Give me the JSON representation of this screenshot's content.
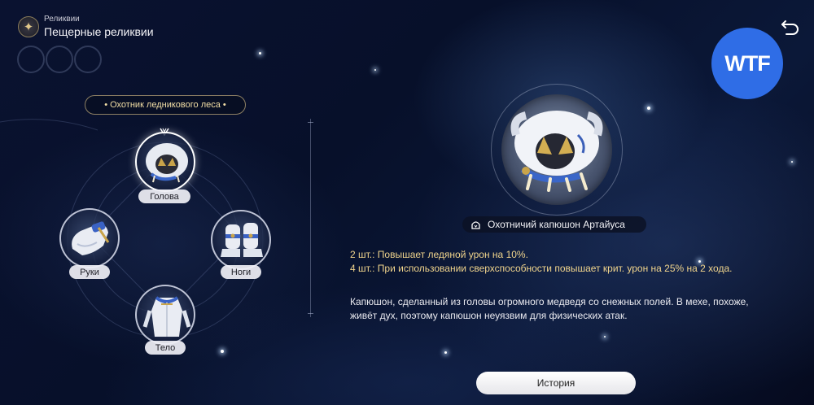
{
  "header": {
    "subtitle": "Реликвии",
    "title": "Пещерные реликвии",
    "icon": "compass-star-icon",
    "back_icon": "return-arrow-icon"
  },
  "watermark": {
    "label": "WTF",
    "color": "#2f6de6"
  },
  "set": {
    "name": "• Охотник ледникового леса •"
  },
  "slots": [
    {
      "label": "Голова",
      "active": true
    },
    {
      "label": "Руки",
      "active": false
    },
    {
      "label": "Ноги",
      "active": false
    },
    {
      "label": "Тело",
      "active": false
    }
  ],
  "item": {
    "name": "Охотничий капюшон Артайуса",
    "name_icon": "hood-icon",
    "bonus_2": "2 шт.: Повышает ледяной урон на 10%.",
    "bonus_4": "4 шт.: При использовании сверхспособности повышает крит. урон на 25% на 2 хода.",
    "description": "Капюшон, сделанный из головы огромного медведя со снежных полей. В мехе, похоже, живёт дух, поэтому капюшон неуязвим для физических атак."
  },
  "history_button": {
    "label": "История"
  },
  "colors": {
    "bonus_text": "#f0d48c",
    "set_text": "#f3dfa6"
  }
}
